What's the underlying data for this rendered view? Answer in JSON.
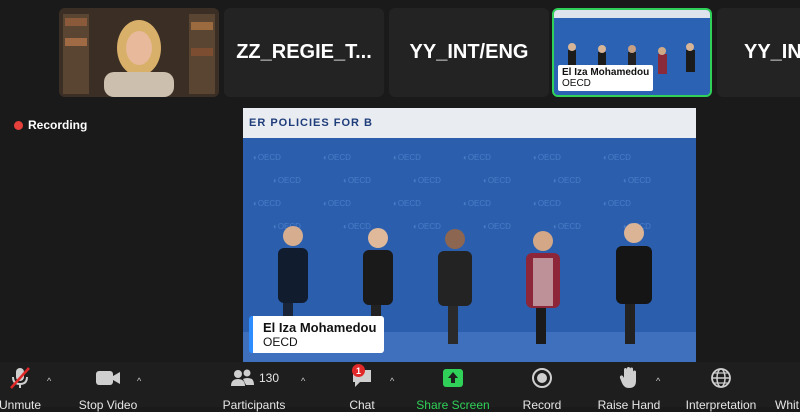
{
  "gallery": {
    "tiles": [
      {
        "name": ""
      },
      {
        "name": "ZZ_REGIE_T..."
      },
      {
        "name": "YY_INT/ENG"
      },
      {
        "name": "El Iza Mohamedou",
        "org": "OECD"
      },
      {
        "name": "YY_INT"
      }
    ]
  },
  "recording": {
    "label": "Recording"
  },
  "main": {
    "banner": "ER POLICIES FOR B",
    "speaker_name": "El Iza Mohamedou",
    "speaker_org": "OECD"
  },
  "toolbar": {
    "unmute": "Unmute",
    "stop_video": "Stop Video",
    "participants": "Participants",
    "participants_count": "130",
    "chat": "Chat",
    "chat_badge": "1",
    "share_screen": "Share Screen",
    "record": "Record",
    "raise_hand": "Raise Hand",
    "interpretation": "Interpretation",
    "whiteboard": "Whit"
  },
  "colors": {
    "share": "#2fd158",
    "recording_dot": "#e5403b",
    "active_border": "#2fd158"
  }
}
